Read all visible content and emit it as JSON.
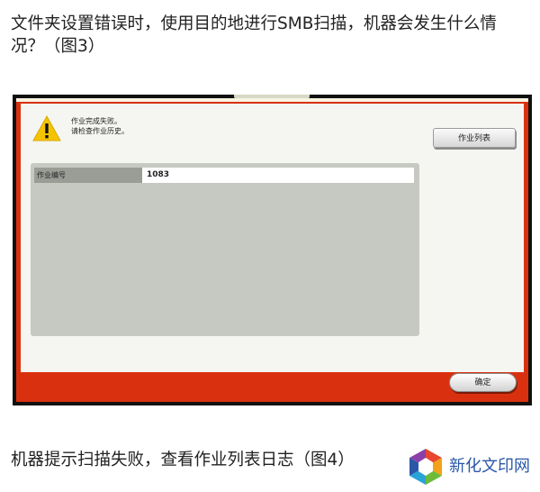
{
  "article": {
    "question": "文件夹设置错误时，使用目的地进行SMB扫描，机器会发生什么情况？（图3）",
    "caption": "机器提示扫描失败，查看作业列表日志（图4）"
  },
  "device_screen": {
    "message_line1": "作业完成失败。",
    "message_line2": "请检查作业历史。",
    "job_list_button": "作业列表",
    "job_number_label": "作业编号",
    "job_number_value": "1083",
    "ok_button": "确定",
    "warning_icon": "warning-triangle-icon",
    "colors": {
      "frame": "#d93110",
      "content": "#f5f6f1",
      "info_box": "#c6c9c2",
      "warning": "#f5c400"
    }
  },
  "watermark": {
    "text": "新化文印网",
    "icon": "hexagon-logo-icon"
  }
}
